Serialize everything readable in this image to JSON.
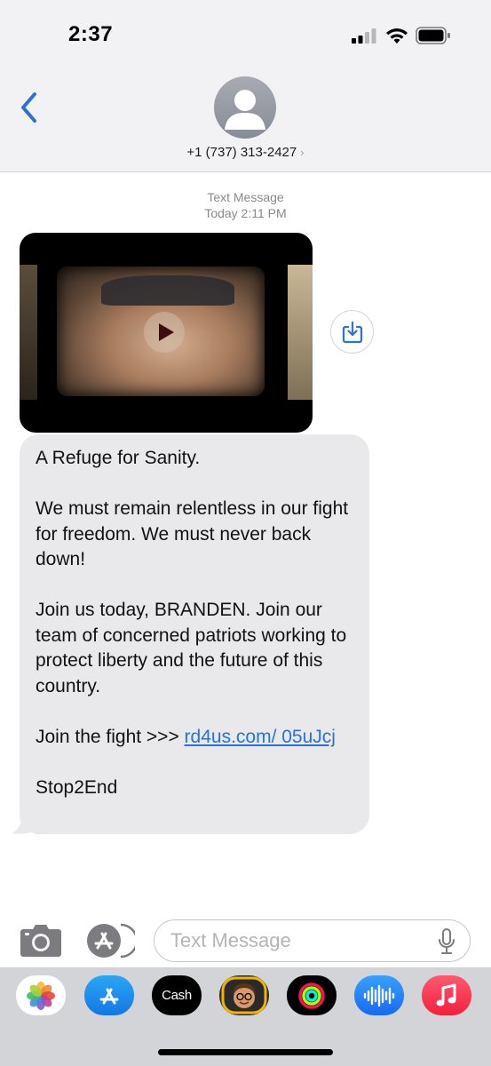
{
  "status_bar": {
    "time": "2:37"
  },
  "header": {
    "contact_number": "+1 (737) 313-2427",
    "chevron": "›",
    "icons": {
      "back": "chevron-left-icon",
      "avatar": "person-placeholder-icon"
    }
  },
  "thread": {
    "service_label": "Text Message",
    "timestamp": "Today 2:11 PM",
    "video": {
      "icon": "play-icon"
    },
    "save_icon": "download-icon",
    "message": {
      "line1": "A Refuge for Sanity.",
      "para2": "We must remain relentless in our fight for freedom. We must never back down!",
      "para3": "Join us today, BRANDEN. Join our team of concerned patriots working to protect liberty and the future of this country.",
      "join_prefix": "Join the fight >>> ",
      "link_text": "rd4us.com/ 05uJcj",
      "stop": "Stop2End"
    }
  },
  "composer": {
    "placeholder": "Text Message",
    "icons": [
      "camera-icon",
      "app-store-icon",
      "microphone-icon"
    ]
  },
  "app_strip": {
    "cash_label": "Cash",
    "apps": [
      "photos",
      "app-store",
      "cash-app",
      "memoji",
      "activity",
      "audio-message",
      "music"
    ]
  },
  "colors": {
    "accent": "#2a72d6",
    "bubble": "#e9e9eb",
    "header_bg": "#f2f2f4"
  }
}
